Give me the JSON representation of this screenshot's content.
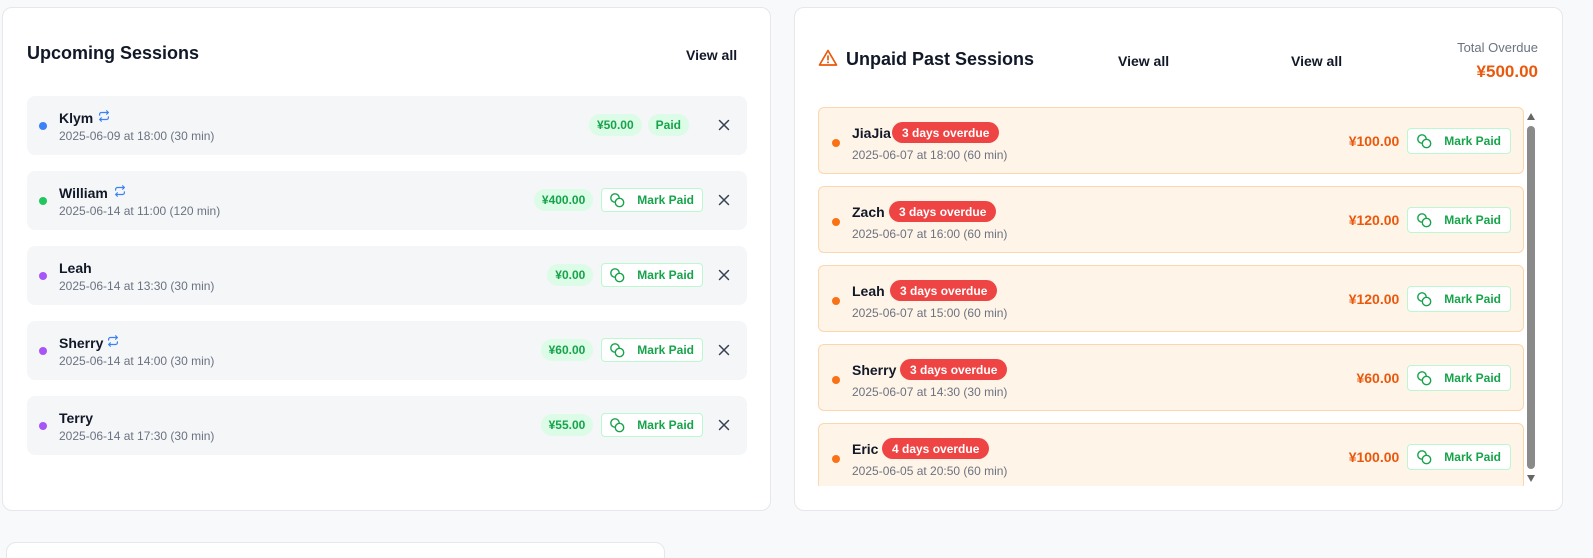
{
  "upcoming": {
    "title": "Upcoming Sessions",
    "view_all": "View all",
    "rows": [
      {
        "name": "Klym",
        "time": "2025-06-09 at 18:00 (30 min)",
        "price": "¥50.00",
        "status": "Paid",
        "dot_color": "#3b82f6",
        "recurring": true
      },
      {
        "name": "William",
        "time": "2025-06-14 at 11:00 (120 min)",
        "price": "¥400.00",
        "action": "Mark Paid",
        "dot_color": "#22c55e",
        "recurring": true
      },
      {
        "name": "Leah",
        "time": "2025-06-14 at 13:30 (30 min)",
        "price": "¥0.00",
        "action": "Mark Paid",
        "dot_color": "#a855f7",
        "recurring": false
      },
      {
        "name": "Sherry",
        "time": "2025-06-14 at 14:00 (30 min)",
        "price": "¥60.00",
        "action": "Mark Paid",
        "dot_color": "#a855f7",
        "recurring": true
      },
      {
        "name": "Terry",
        "time": "2025-06-14 at 17:30 (30 min)",
        "price": "¥55.00",
        "action": "Mark Paid",
        "dot_color": "#a855f7",
        "recurring": false
      }
    ]
  },
  "unpaid": {
    "title": "Unpaid Past Sessions",
    "view_all_1": "View all",
    "view_all_2": "View all",
    "total_label": "Total Overdue",
    "total_value": "¥500.00",
    "rows": [
      {
        "name": "JiaJia",
        "badge": "3 days overdue",
        "time": "2025-06-07 at 18:00 (60 min)",
        "amount": "¥100.00",
        "action": "Mark Paid"
      },
      {
        "name": "Zach",
        "badge": "3 days overdue",
        "time": "2025-06-07 at 16:00 (60 min)",
        "amount": "¥120.00",
        "action": "Mark Paid"
      },
      {
        "name": "Leah",
        "badge": "3 days overdue",
        "time": "2025-06-07 at 15:00 (60 min)",
        "amount": "¥120.00",
        "action": "Mark Paid"
      },
      {
        "name": "Sherry",
        "badge": "3 days overdue",
        "time": "2025-06-07 at 14:30 (30 min)",
        "amount": "¥60.00",
        "action": "Mark Paid"
      },
      {
        "name": "Eric",
        "badge": "4 days overdue",
        "time": "2025-06-05 at 20:50 (60 min)",
        "amount": "¥100.00",
        "action": "Mark Paid"
      }
    ]
  },
  "colors": {
    "accent_green": "#16a34a",
    "accent_orange": "#ea580c",
    "overdue_red": "#ef4444"
  },
  "icons": [
    "repeat-icon",
    "coins-icon",
    "close-icon",
    "warning-triangle-icon"
  ]
}
